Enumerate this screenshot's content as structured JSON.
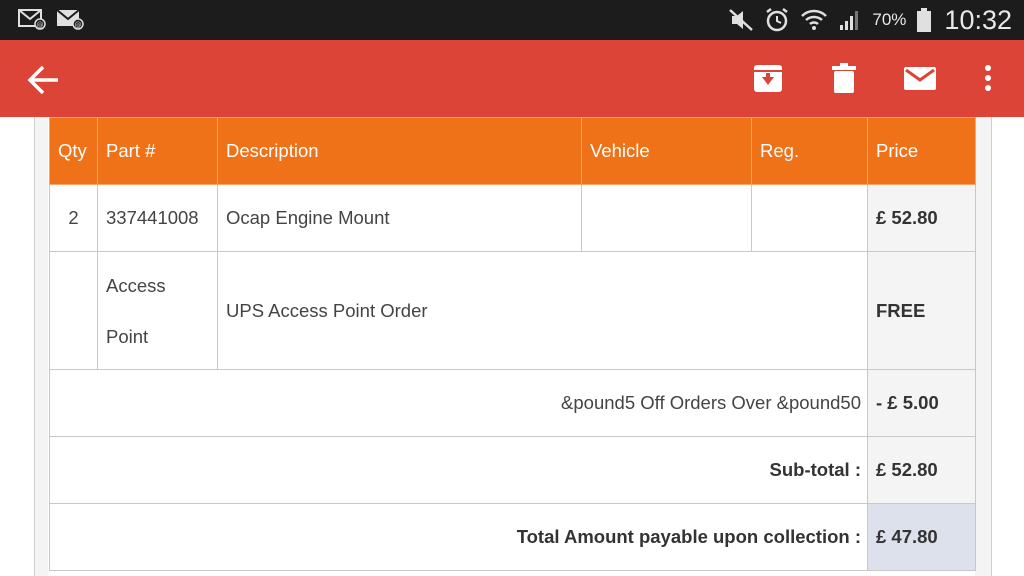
{
  "status_bar": {
    "battery_percent": "70%",
    "time": "10:32",
    "icons": [
      "email-notification-icon",
      "email-notification-icon",
      "mute-icon",
      "alarm-icon",
      "wifi-icon",
      "signal-icon",
      "battery-icon"
    ]
  },
  "app_bar": {
    "background": "#db4437",
    "icons": [
      "back-arrow-icon",
      "archive-icon",
      "delete-icon",
      "mark-unread-icon",
      "overflow-menu-icon"
    ]
  },
  "order_table": {
    "header_color": "#f07218",
    "columns": [
      "Qty",
      "Part #",
      "Description",
      "Vehicle",
      "Reg.",
      "Price"
    ],
    "items": [
      {
        "qty": "2",
        "part": "337441008",
        "description": "Ocap Engine Mount",
        "vehicle": "",
        "reg": "",
        "price": "£ 52.80"
      }
    ],
    "access_point": {
      "part_line1": "Access",
      "part_line2": "Point",
      "description": "UPS Access Point Order",
      "price": "FREE"
    },
    "discount": {
      "label": "&pound5 Off Orders Over &pound50",
      "value": "- £ 5.00"
    },
    "subtotal": {
      "label": "Sub-total :",
      "value": "£ 52.80"
    },
    "total": {
      "label": "Total Amount payable upon collection :",
      "value": "£ 47.80"
    }
  }
}
